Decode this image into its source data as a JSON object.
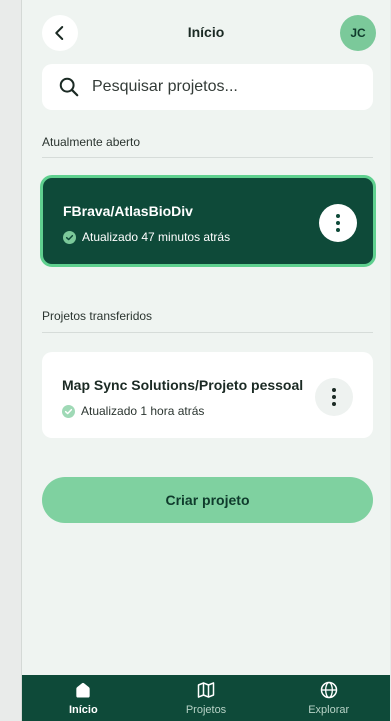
{
  "header": {
    "title": "Início",
    "avatar_initials": "JC",
    "back_icon": "chevron-left-icon"
  },
  "search": {
    "placeholder": "Pesquisar projetos...",
    "icon": "search-icon"
  },
  "sections": {
    "open_label": "Atualmente aberto",
    "transferred_label": "Projetos transferidos"
  },
  "open_project": {
    "title": "FBrava/AtlasBioDiv",
    "status": "Atualizado 47 minutos atrás"
  },
  "transferred_projects": [
    {
      "title": "Map Sync Solutions/Projeto pessoal",
      "status": "Atualizado 1 hora atrás"
    }
  ],
  "create_button": "Criar projeto",
  "bottom_nav": [
    {
      "label": "Início",
      "icon": "home-icon",
      "active": true
    },
    {
      "label": "Projetos",
      "icon": "map-icon",
      "active": false
    },
    {
      "label": "Explorar",
      "icon": "globe-icon",
      "active": false
    }
  ],
  "colors": {
    "primary_dark": "#0e4a39",
    "accent_green": "#5fd08f",
    "button_green": "#7fd1a0",
    "background": "#eff4f1"
  }
}
